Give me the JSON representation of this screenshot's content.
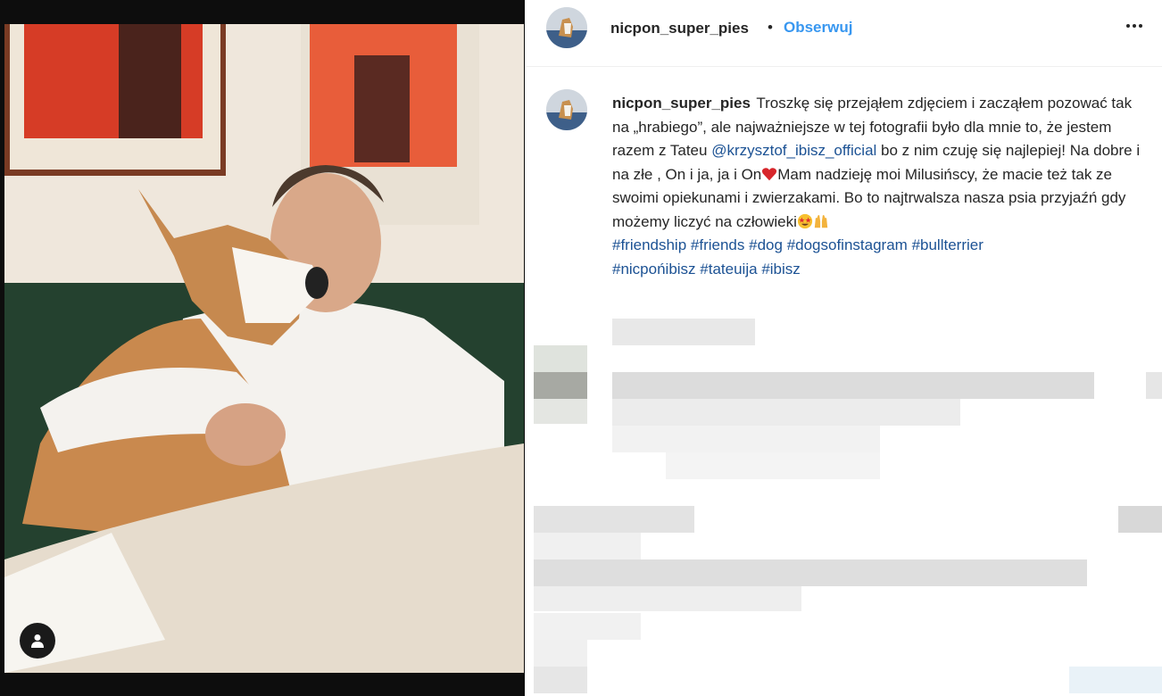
{
  "post": {
    "username": "nicpon_super_pies",
    "separator": "•",
    "follow_label": "Obserwuj",
    "caption": {
      "username": "nicpon_super_pies",
      "text_1": "Troszkę się przejąłem zdjęciem i zacząłem pozować tak na „hrabiego”, ale najważniejsze w tej fotografii było dla mnie to, że jestem razem z Tateu ",
      "mention": "@krzysztof_ibisz_official",
      "text_2": " bo z nim czuję się najlepiej! Na dobre i na złe , On i ja, ja i On",
      "text_3": "Mam nadzieję moi Milusińscy, że macie też tak ze swoimi opiekunami i zwierzakami. Bo to najtrwalsza nasza psia przyjaźń gdy możemy liczyć na człowieki",
      "hashtags": [
        "#friendship",
        "#friends",
        "#dog",
        "#dogsofinstagram",
        "#bullterrier",
        "#nicpońibisz",
        "#tateuija",
        "#ibisz"
      ]
    },
    "icons": {
      "user_tag": "user-tag-icon",
      "more": "more-options-icon",
      "heart": "red-heart-emoji",
      "star_eyes": "star-struck-emoji",
      "raised_hands": "raised-hands-emoji"
    },
    "colors": {
      "link": "#1c5294",
      "follow": "#3897f0",
      "text": "#262626"
    }
  }
}
